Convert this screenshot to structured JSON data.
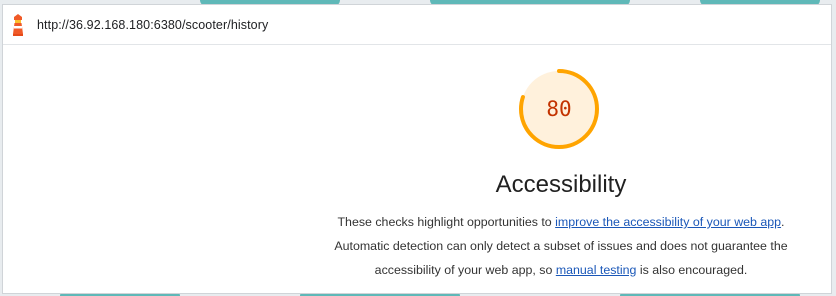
{
  "browser": {
    "url": "http://36.92.168.180:6380/scooter/history"
  },
  "report": {
    "score": 80,
    "score_text": "80",
    "category_title": "Accessibility",
    "description": {
      "part1": "These checks highlight opportunities to ",
      "link1": "improve the accessibility of your web app",
      "part2": ". Automatic detection can only detect a subset of issues and does not guarantee the accessibility of your web app, so ",
      "link2": "manual testing",
      "part3": " is also encouraged."
    }
  },
  "colors": {
    "gauge_arc": "#ffa400",
    "gauge_track": "#fff1dc",
    "score_text": "#c33300",
    "link": "#1a57b8"
  },
  "icons": {
    "logo": "lighthouse-icon"
  }
}
